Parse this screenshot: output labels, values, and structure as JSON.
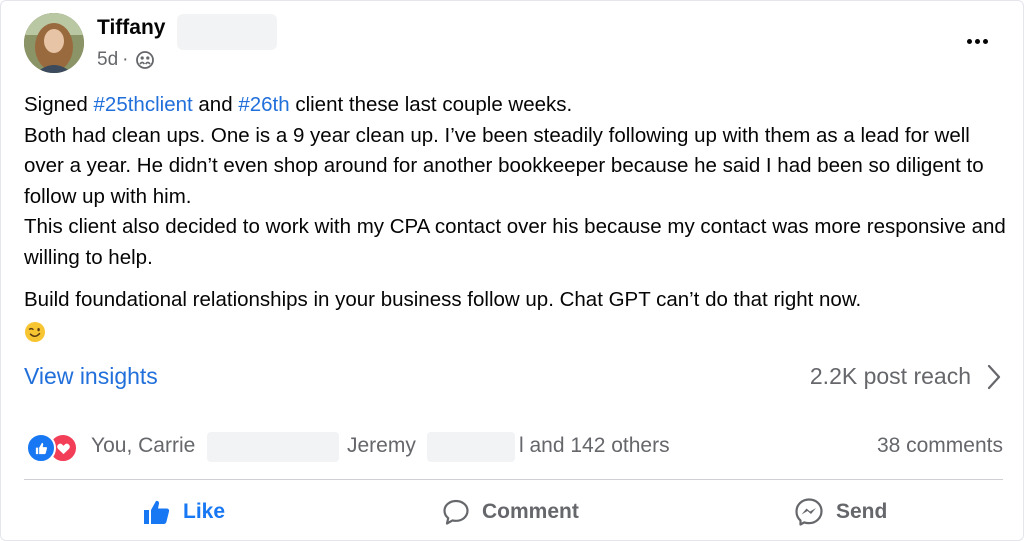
{
  "post": {
    "author_first": "Tiffany",
    "time": "5d",
    "time_sep": "·",
    "privacy_icon": "friends-icon",
    "line1_pre": "Signed ",
    "tag1": "#25thclient",
    "line1_mid": " and ",
    "tag2": "#26th",
    "line1_post": " client these last couple weeks.",
    "paragraph1": "Both had clean ups. One is a 9 year clean up. I’ve been steadily following up with them as a lead for well over a year. He didn’t even shop around for another bookkeeper because he said I had been so diligent to follow up with him.",
    "paragraph2": "This client also decided to work with my CPA contact over his because my contact was more responsive and willing to help.",
    "paragraph3": "Build foundational relationships in your business follow up. Chat GPT can’t do that right now.",
    "emoji": "winking-face"
  },
  "insights": {
    "link": "View insights",
    "reach": "2.2K post reach"
  },
  "reactions": {
    "icons": [
      "like",
      "love"
    ],
    "names_start": "You, Carrie",
    "name2": "Jeremy",
    "names_end": "l and 142 others",
    "comments": "38 comments"
  },
  "actions": {
    "like": "Like",
    "comment": "Comment",
    "send": "Send"
  },
  "colors": {
    "link_blue": "#216fdb",
    "like_blue": "#1877f2",
    "love_red": "#f33e58",
    "secondary_text": "#65676b"
  }
}
